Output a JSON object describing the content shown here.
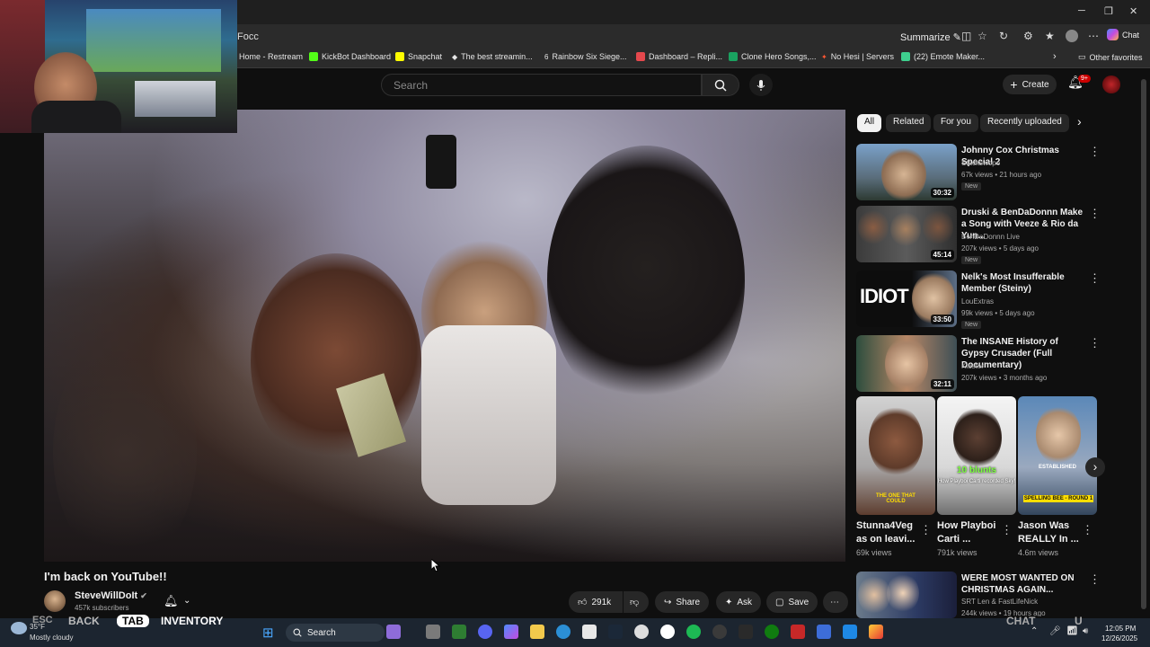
{
  "browser": {
    "address": "Focc",
    "summarize_label": "Summarize",
    "chat_label": "Chat",
    "other_favorites": "Other favorites",
    "window_controls": [
      "minimize-icon",
      "restore-icon",
      "close-icon"
    ]
  },
  "bookmarks": [
    {
      "label": "Home - Restream",
      "color": "#1f6feb"
    },
    {
      "label": "KickBot Dashboard",
      "color": "#53fc18"
    },
    {
      "label": "Snapchat",
      "color": "#fffc00"
    },
    {
      "label": "The best streamin...",
      "color": "#ffffff"
    },
    {
      "label": "Rainbow Six Siege...",
      "color": "#cccccc"
    },
    {
      "label": "Dashboard – Repli...",
      "color": "#e5484d"
    },
    {
      "label": "Clone Hero Songs,...",
      "color": "#1aa260"
    },
    {
      "label": "No Hesi | Servers",
      "color": "#ff5733"
    },
    {
      "label": "(22) Emote Maker...",
      "color": "#3ecf8e"
    }
  ],
  "youtube": {
    "search_placeholder": "Search",
    "create_label": "Create",
    "notif_count": "9+"
  },
  "video": {
    "title": "I'm back on YouTube!!",
    "channel": "SteveWillDoIt",
    "subscribers": "457k subscribers",
    "likes": "291k",
    "share_label": "Share",
    "ask_label": "Ask",
    "save_label": "Save"
  },
  "chips": [
    {
      "label": "All",
      "active": true
    },
    {
      "label": "Related",
      "active": false
    },
    {
      "label": "For you",
      "active": false
    },
    {
      "label": "Recently uploaded",
      "active": false
    }
  ],
  "recommendations": [
    {
      "title": "Johnny Cox Christmas Special 2",
      "channel": "Stackswopo",
      "meta": "67k views • 21 hours ago",
      "new": "New",
      "duration": "30:32"
    },
    {
      "title": "Druski & BenDaDonnn Make a Song with Veeze & Rio da Yun...",
      "channel": "BenDaDonnn Live",
      "meta": "207k views • 5 days ago",
      "new": "New",
      "duration": "45:14"
    },
    {
      "title": "Nelk's Most Insufferable Member (Steiny)",
      "channel": "LouExtras",
      "meta": "99k views • 5 days ago",
      "new": "New",
      "duration": "33:50",
      "thumb_text": "IDIOT"
    },
    {
      "title": "The INSANE History of Gypsy Crusader (Full Documentary)",
      "channel": "Kluster",
      "meta": "207k views • 3 months ago",
      "new": "",
      "duration": "32:11"
    }
  ],
  "shorts": [
    {
      "title": "Stunna4Veg as on leavi...",
      "views": "69k views",
      "caption": "THE ONE THAT COULD"
    },
    {
      "title": "How Playboi Carti ...",
      "views": "791k views",
      "caption": "10 blunts",
      "caption2": "How Playboi Carti recorded Sky!"
    },
    {
      "title": "Jason Was REALLY In ...",
      "views": "4.6m views",
      "caption": "SPELLING BEE - ROUND 1",
      "caption2": "ESTABLISHED"
    }
  ],
  "last_rec": {
    "title": "WERE MOST WANTED ON CHRISTMAS AGAIN...",
    "channel": "SRT Len & FastLifeNick",
    "meta": "244k views • 19 hours ago"
  },
  "taskbar": {
    "weather_temp": "35°F",
    "weather_text": "Mostly cloudy",
    "search_label": "Search",
    "time": "12:05 PM",
    "date": "12/26/2025"
  },
  "game_overlay": {
    "esc": "ESC",
    "back": "BACK",
    "tab": "TAB",
    "inventory": "INVENTORY",
    "chat": "CHAT",
    "right_label": "U"
  }
}
